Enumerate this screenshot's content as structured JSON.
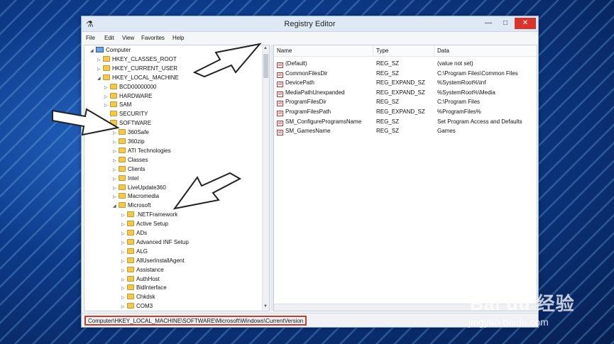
{
  "window": {
    "title": "Registry Editor",
    "min_label": "—",
    "max_label": "□",
    "close_label": "✕"
  },
  "menu": [
    "File",
    "Edit",
    "View",
    "Favorites",
    "Help"
  ],
  "tree": [
    {
      "label": "Computer",
      "level": 0,
      "expander": "◢",
      "icon": "computer"
    },
    {
      "label": "HKEY_CLASSES_ROOT",
      "level": 1,
      "expander": "▷",
      "icon": "folder"
    },
    {
      "label": "HKEY_CURRENT_USER",
      "level": 1,
      "expander": "▷",
      "icon": "folder"
    },
    {
      "label": "HKEY_LOCAL_MACHINE",
      "level": 1,
      "expander": "◢",
      "icon": "folder"
    },
    {
      "label": "BCD00000000",
      "level": 2,
      "expander": "▷",
      "icon": "folder"
    },
    {
      "label": "HARDWARE",
      "level": 2,
      "expander": "▷",
      "icon": "folder"
    },
    {
      "label": "SAM",
      "level": 2,
      "expander": "▷",
      "icon": "folder"
    },
    {
      "label": "SECURITY",
      "level": 2,
      "expander": "",
      "icon": "folder"
    },
    {
      "label": "SOFTWARE",
      "level": 2,
      "expander": "◢",
      "icon": "folder"
    },
    {
      "label": "360Safe",
      "level": 3,
      "expander": "▷",
      "icon": "folder"
    },
    {
      "label": "360zip",
      "level": 3,
      "expander": "▷",
      "icon": "folder"
    },
    {
      "label": "ATI Technologies",
      "level": 3,
      "expander": "▷",
      "icon": "folder"
    },
    {
      "label": "Classes",
      "level": 3,
      "expander": "▷",
      "icon": "folder"
    },
    {
      "label": "Clients",
      "level": 3,
      "expander": "▷",
      "icon": "folder"
    },
    {
      "label": "Intel",
      "level": 3,
      "expander": "▷",
      "icon": "folder"
    },
    {
      "label": "LiveUpdate360",
      "level": 3,
      "expander": "▷",
      "icon": "folder"
    },
    {
      "label": "Macromedia",
      "level": 3,
      "expander": "▷",
      "icon": "folder"
    },
    {
      "label": "Microsoft",
      "level": 3,
      "expander": "◢",
      "icon": "folder"
    },
    {
      "label": ".NETFramework",
      "level": 4,
      "expander": "▷",
      "icon": "folder"
    },
    {
      "label": "Active Setup",
      "level": 4,
      "expander": "▷",
      "icon": "folder"
    },
    {
      "label": "ADs",
      "level": 4,
      "expander": "▷",
      "icon": "folder"
    },
    {
      "label": "Advanced INF Setup",
      "level": 4,
      "expander": "▷",
      "icon": "folder"
    },
    {
      "label": "ALG",
      "level": 4,
      "expander": "▷",
      "icon": "folder"
    },
    {
      "label": "AllUserInstallAgent",
      "level": 4,
      "expander": "▷",
      "icon": "folder"
    },
    {
      "label": "Assistance",
      "level": 4,
      "expander": "▷",
      "icon": "folder"
    },
    {
      "label": "AuthHost",
      "level": 4,
      "expander": "▷",
      "icon": "folder"
    },
    {
      "label": "BidInterface",
      "level": 4,
      "expander": "▷",
      "icon": "folder"
    },
    {
      "label": "Chkdsk",
      "level": 4,
      "expander": "▷",
      "icon": "folder"
    },
    {
      "label": "COM3",
      "level": 4,
      "expander": "▷",
      "icon": "folder"
    }
  ],
  "columns": [
    "Name",
    "Type",
    "Data"
  ],
  "values": [
    {
      "name": "(Default)",
      "type": "REG_SZ",
      "data": "(value not set)"
    },
    {
      "name": "CommonFilesDir",
      "type": "REG_SZ",
      "data": "C:\\Program Files\\Common Files"
    },
    {
      "name": "DevicePath",
      "type": "REG_EXPAND_SZ",
      "data": "%SystemRoot%\\inf"
    },
    {
      "name": "MediaPathUnexpanded",
      "type": "REG_EXPAND_SZ",
      "data": "%SystemRoot%\\Media"
    },
    {
      "name": "ProgramFilesDir",
      "type": "REG_SZ",
      "data": "C:\\Program Files"
    },
    {
      "name": "ProgramFilesPath",
      "type": "REG_EXPAND_SZ",
      "data": "%ProgramFiles%"
    },
    {
      "name": "SM_ConfigureProgramsName",
      "type": "REG_SZ",
      "data": "Set Program Access and Defaults"
    },
    {
      "name": "SM_GamesName",
      "type": "REG_SZ",
      "data": "Games"
    }
  ],
  "value_icon_text": "ab",
  "status": {
    "path": "Computer\\HKEY_LOCAL_MACHINE\\SOFTWARE\\Microsoft\\Windows\\CurrentVersion"
  },
  "watermark": {
    "logo": "Bai du 经验",
    "url": "jingyan.baidu.com"
  },
  "colors": {
    "close_button": "#d9342b",
    "highlight_border": "#d23a2a",
    "folder": "#f2c94c"
  }
}
